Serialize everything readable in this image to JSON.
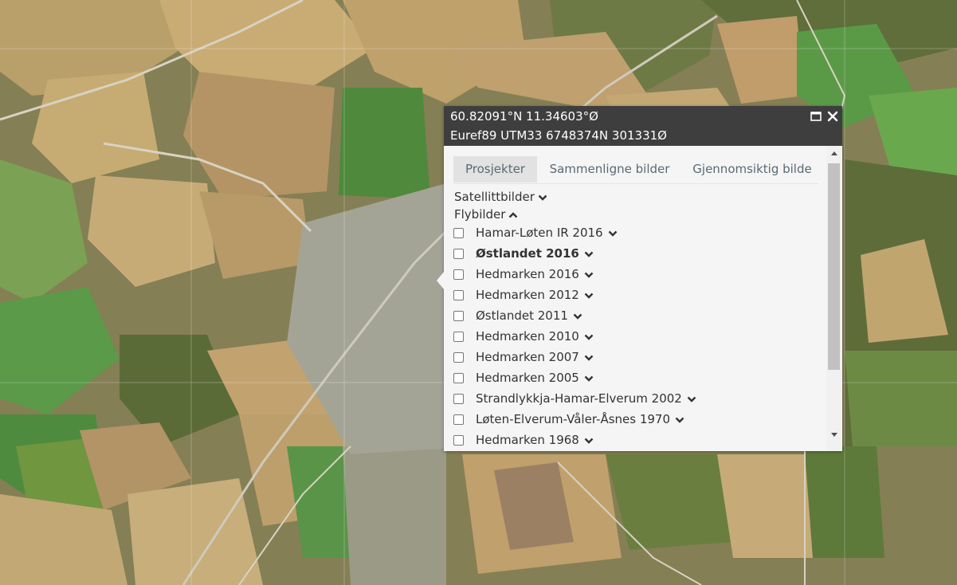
{
  "map": {
    "type": "aerial-photo"
  },
  "popup": {
    "coord_text": "60.82091°N 11.34603°Ø",
    "utm_text": "Euref89 UTM33 6748374N 301331Ø",
    "maximize_icon": "maximize-icon",
    "close_icon": "close-icon",
    "tabs": [
      {
        "label": "Prosjekter",
        "active": true
      },
      {
        "label": "Sammenligne bilder",
        "active": false
      },
      {
        "label": "Gjennomsiktig bilde",
        "active": false
      }
    ],
    "groups": [
      {
        "label": "Satellittbilder",
        "icon": "chevron-down-icon"
      },
      {
        "label": "Flybilder",
        "icon": "chevron-up-icon"
      }
    ],
    "items": [
      {
        "label": "Hamar-Løten IR 2016",
        "checked": false,
        "bold": false
      },
      {
        "label": "Østlandet 2016",
        "checked": false,
        "bold": true
      },
      {
        "label": "Hedmarken 2016",
        "checked": false,
        "bold": false
      },
      {
        "label": "Hedmarken 2012",
        "checked": false,
        "bold": false
      },
      {
        "label": "Østlandet 2011",
        "checked": false,
        "bold": false
      },
      {
        "label": "Hedmarken 2010",
        "checked": false,
        "bold": false
      },
      {
        "label": "Hedmarken 2007",
        "checked": false,
        "bold": false
      },
      {
        "label": "Hedmarken 2005",
        "checked": false,
        "bold": false
      },
      {
        "label": "Strandlykkja-Hamar-Elverum 2002",
        "checked": false,
        "bold": false
      },
      {
        "label": "Løten-Elverum-Våler-Åsnes 1970",
        "checked": false,
        "bold": false
      },
      {
        "label": "Hedmarken 1968",
        "checked": false,
        "bold": false
      }
    ],
    "colors": {
      "header_bg": "#3e3e3e",
      "panel_bg": "#f5f5f5",
      "tab_active_bg": "#e2e2e2",
      "tab_text": "#5a6a72"
    }
  }
}
